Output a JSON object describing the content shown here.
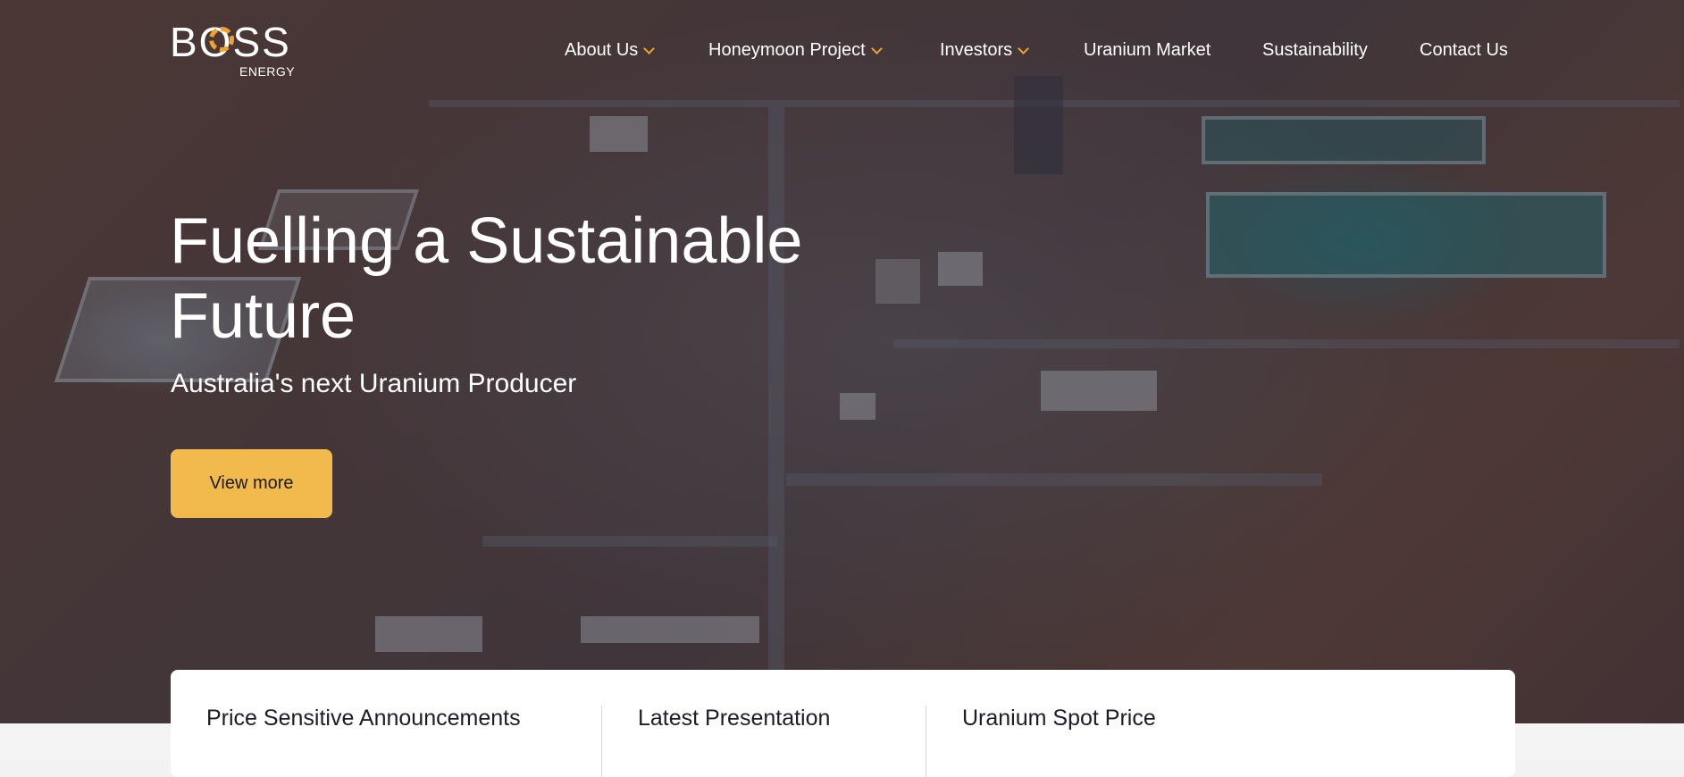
{
  "brand": {
    "logo_word": "BOSS",
    "logo_sub": "ENERGY"
  },
  "nav": {
    "items": [
      {
        "label": "About Us",
        "has_dropdown": true
      },
      {
        "label": "Honeymoon Project",
        "has_dropdown": true
      },
      {
        "label": "Investors",
        "has_dropdown": true
      },
      {
        "label": "Uranium Market",
        "has_dropdown": false
      },
      {
        "label": "Sustainability",
        "has_dropdown": false
      },
      {
        "label": "Contact Us",
        "has_dropdown": false
      }
    ]
  },
  "hero": {
    "headline_line1": "Fuelling a Sustainable",
    "headline_line2": "Future",
    "subheadline": "Australia's next Uranium Producer",
    "cta_label": "View more"
  },
  "info_card": {
    "columns": [
      {
        "title": "Price Sensitive Announcements"
      },
      {
        "title": "Latest Presentation"
      },
      {
        "title": "Uranium Spot Price"
      }
    ]
  },
  "colors": {
    "accent": "#f2b94c",
    "logo_accent": "#f0a22e",
    "card_text": "#1c1c2a"
  },
  "icons": {
    "nav_dropdown": "chevron-down-icon"
  }
}
